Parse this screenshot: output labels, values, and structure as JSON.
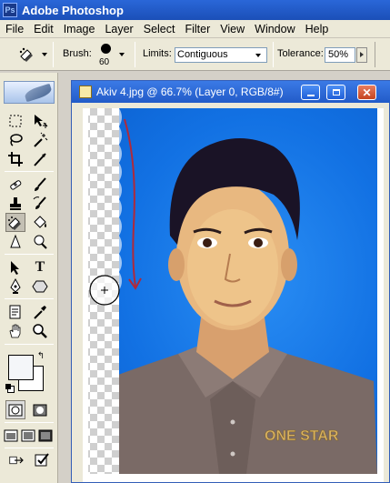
{
  "app": {
    "title": "Adobe Photoshop",
    "logo_text": "Ps"
  },
  "menu": [
    "File",
    "Edit",
    "Image",
    "Layer",
    "Select",
    "Filter",
    "View",
    "Window",
    "Help"
  ],
  "options": {
    "brush_label": "Brush:",
    "brush_size": "60",
    "limits_label": "Limits:",
    "limits_value": "Contiguous",
    "tolerance_label": "Tolerance:",
    "tolerance_value": "50%"
  },
  "toolbox": {
    "tools": [
      "rectangular-marquee",
      "move",
      "lasso",
      "magic-wand",
      "crop",
      "slice",
      "healing-brush",
      "brush",
      "clone-stamp",
      "history-brush",
      "background-eraser",
      "paint-bucket",
      "sharpen",
      "dodge",
      "path-selection",
      "type",
      "pen",
      "custom-shape",
      "notes",
      "eyedropper",
      "hand",
      "zoom"
    ],
    "active_tool": "background-eraser",
    "foreground_color": "#f4f6f9",
    "background_color": "#ffffff"
  },
  "document": {
    "title": "Akiv 4.jpg @ 66.7% (Layer 0, RGB/8#)",
    "shirt_text": "ONE STAR",
    "background_color": "#1271e3",
    "annotation_color": "#b02a3a"
  }
}
